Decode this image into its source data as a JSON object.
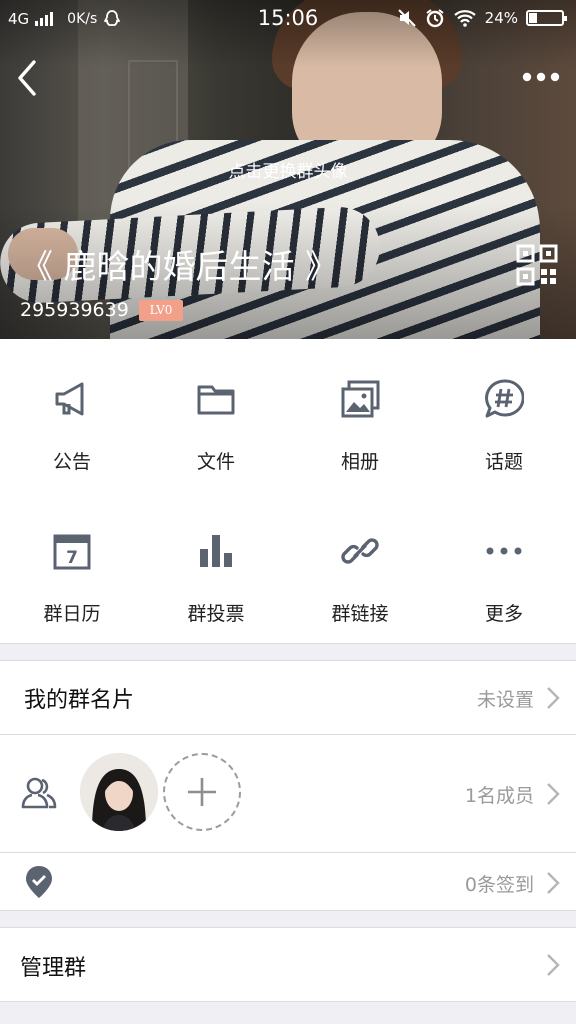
{
  "status_bar": {
    "network": "4G",
    "speed": "0K/s",
    "time": "15:06",
    "battery_percent": "24%",
    "battery_level": 0.24
  },
  "header": {
    "change_avatar_hint": "点击更换群头像",
    "group_name": "《 鹿晗的婚后生活 》",
    "group_id": "295939639",
    "level_badge": "LV0"
  },
  "features": [
    {
      "label": "公告",
      "icon": "megaphone-icon"
    },
    {
      "label": "文件",
      "icon": "folder-icon"
    },
    {
      "label": "相册",
      "icon": "photo-album-icon"
    },
    {
      "label": "话题",
      "icon": "hashtag-topic-icon"
    },
    {
      "label": "群日历",
      "icon": "calendar-icon"
    },
    {
      "label": "群投票",
      "icon": "bar-chart-vote-icon"
    },
    {
      "label": "群链接",
      "icon": "link-icon"
    },
    {
      "label": "更多",
      "icon": "more-dots-icon"
    }
  ],
  "calendar_day": "7",
  "my_card": {
    "label": "我的群名片",
    "value": "未设置"
  },
  "members": {
    "count_text": "1名成员"
  },
  "checkin": {
    "value": "0条签到"
  },
  "manage": {
    "label": "管理群"
  },
  "colors": {
    "accent_badge": "#f2a08a",
    "icon_gray": "#5b6371",
    "divider": "#efeff4"
  }
}
